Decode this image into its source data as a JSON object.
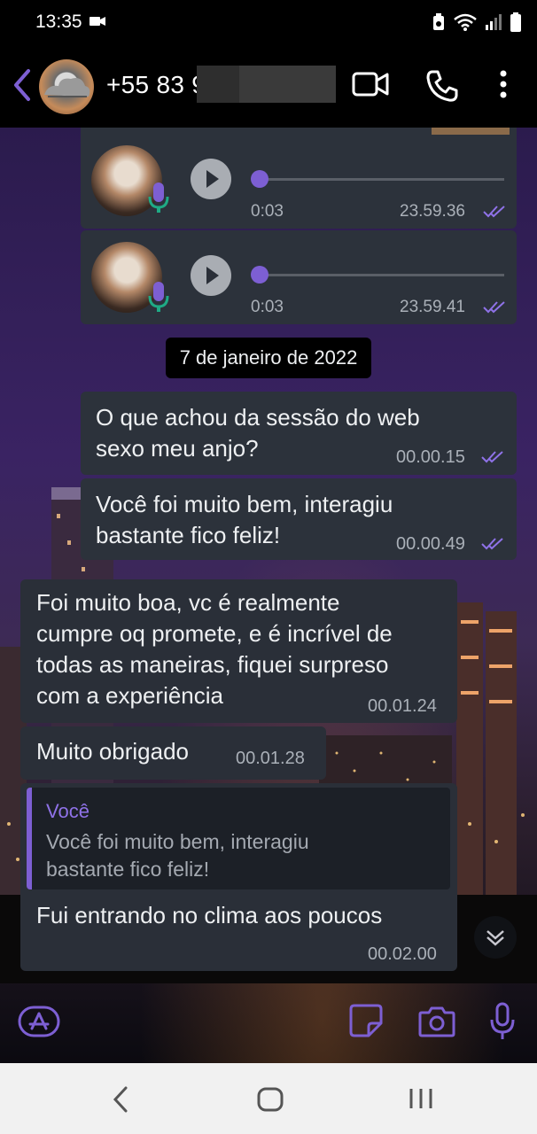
{
  "status": {
    "time": "13:35"
  },
  "header": {
    "contact_name": "+55 83 9"
  },
  "voice_messages": [
    {
      "duration": "0:03",
      "time": "23.59.36"
    },
    {
      "duration": "0:03",
      "time": "23.59.41"
    }
  ],
  "date_separator": "7 de janeiro de 2022",
  "messages": [
    {
      "direction": "outgoing",
      "lines": [
        "O que achou da sessão do web",
        "sexo meu anjo?"
      ],
      "time": "00.00.15"
    },
    {
      "direction": "outgoing",
      "lines": [
        "Você foi muito bem, interagiu",
        "bastante fico feliz!"
      ],
      "time": "00.00.49"
    },
    {
      "direction": "incoming",
      "lines": [
        "Foi muito boa, vc é realmente",
        "cumpre oq promete, e é incrível de",
        "todas as maneiras, fiquei surpreso",
        "com a experiência"
      ],
      "time": "00.01.24"
    },
    {
      "direction": "incoming",
      "lines": [
        "Muito obrigado"
      ],
      "time": "00.01.28"
    },
    {
      "direction": "incoming",
      "reply_to": {
        "author": "Você",
        "lines": [
          "Você foi muito bem, interagiu",
          "bastante fico feliz!"
        ]
      },
      "lines": [
        "Fui entrando no clima aos poucos"
      ],
      "time": "00.02.00"
    }
  ],
  "colors": {
    "accent": "#7d5fd3",
    "bubble": "#2a2f38",
    "nav_bar": "#f1f1f1"
  },
  "icons": [
    "back-icon",
    "video-call-icon",
    "phone-icon",
    "more-vert-icon",
    "play-icon",
    "mic-icon",
    "read-ticks-icon",
    "scroll-down-icon",
    "apps-icon",
    "sticker-icon",
    "camera-icon",
    "microphone-icon",
    "nav-back-icon",
    "nav-home-icon",
    "nav-recents-icon"
  ]
}
